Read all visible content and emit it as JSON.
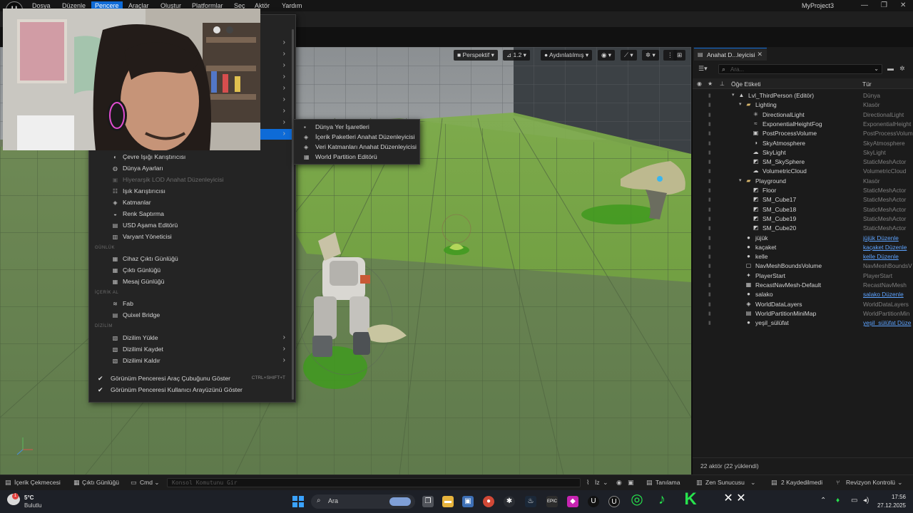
{
  "menubar": {
    "items": [
      "Dosya",
      "Düzenle",
      "Pencere",
      "Araçlar",
      "Oluştur",
      "Platformlar",
      "Seç",
      "Aktör",
      "Yardım"
    ],
    "active_index": 2,
    "project": "MyProject3"
  },
  "viewport": {
    "perspective": "Perspektif",
    "speed": "1.2",
    "lit": "Aydınlatılmış"
  },
  "window_menu": {
    "items": [
      {
        "label": "Çevre Işığı Karıştırıcısı",
        "icon": "bulb-icon"
      },
      {
        "label": "Dünya Ayarları",
        "icon": "globe-icon"
      },
      {
        "label": "Hiyerarşik LOD Anahat Düzenleyicisi",
        "icon": "hlod-icon",
        "disabled": true
      },
      {
        "label": "Işık Karıştırıcısı",
        "icon": "light-mixer-icon"
      },
      {
        "label": "Katmanlar",
        "icon": "layers-icon"
      },
      {
        "label": "Renk Saptırma",
        "icon": "color-icon"
      },
      {
        "label": "USD Aşama Editörü",
        "icon": "usd-icon"
      },
      {
        "label": "Varyant Yöneticisi",
        "icon": "variant-icon"
      }
    ],
    "section_log": "GÜNLÜK",
    "log_items": [
      {
        "label": "Cihaz Çıktı Günlüğü",
        "icon": "device-log-icon"
      },
      {
        "label": "Çıktı Günlüğü",
        "icon": "output-log-icon"
      },
      {
        "label": "Mesaj Günlüğü",
        "icon": "message-log-icon"
      }
    ],
    "section_content": "İÇERİK AL",
    "content_items": [
      {
        "label": "Fab",
        "icon": "fab-icon"
      },
      {
        "label": "Quixel Bridge",
        "icon": "bridge-icon"
      }
    ],
    "section_layout": "DİZİLİM",
    "layout_items": [
      {
        "label": "Dizilim Yükle",
        "icon": "layout-load-icon"
      },
      {
        "label": "Dizilimi Kaydet",
        "icon": "layout-save-icon"
      },
      {
        "label": "Dizilimi Kaldır",
        "icon": "layout-remove-icon"
      }
    ],
    "check_items": [
      {
        "label": "Görünüm Penceresi Araç Çubuğunu Göster",
        "shortcut": "CTRL+SHIFT+T"
      },
      {
        "label": "Görünüm Penceresi Kullanıcı Arayüzünü Göster",
        "shortcut": ""
      }
    ]
  },
  "submenu": {
    "items": [
      {
        "label": "Dünya Yer İşaretleri",
        "icon": "bookmark-icon"
      },
      {
        "label": "İçerik Paketleri Anahat Düzenleyicisi",
        "icon": "content-bundle-icon"
      },
      {
        "label": "Veri Katmanları Anahat Düzenleyicisi",
        "icon": "data-layers-icon"
      },
      {
        "label": "World Partition Editörü",
        "icon": "world-partition-icon"
      }
    ]
  },
  "outliner": {
    "tab_title": "Anahat D...leyicisi",
    "search_placeholder": "Ara...",
    "col_label": "Öğe Etiketi",
    "col_type": "Tür",
    "rows": [
      {
        "label": "Lvl_ThirdPerson (Editör)",
        "type": "Dünya",
        "depth": 0,
        "icon": "level-icon",
        "caret": true
      },
      {
        "label": "Lighting",
        "type": "Klasör",
        "depth": 1,
        "icon": "folder-icon",
        "caret": true
      },
      {
        "label": "DirectionalLight",
        "type": "DirectionalLight",
        "depth": 2,
        "icon": "directional-light-icon"
      },
      {
        "label": "ExponentialHeightFog",
        "type": "ExponentialHeight",
        "depth": 2,
        "icon": "fog-icon"
      },
      {
        "label": "PostProcessVolume",
        "type": "PostProcessVolume",
        "depth": 2,
        "icon": "post-process-icon"
      },
      {
        "label": "SkyAtmosphere",
        "type": "SkyAtmosphere",
        "depth": 2,
        "icon": "sky-atmosphere-icon"
      },
      {
        "label": "SkyLight",
        "type": "SkyLight",
        "depth": 2,
        "icon": "skylight-icon"
      },
      {
        "label": "SM_SkySphere",
        "type": "StaticMeshActor",
        "depth": 2,
        "icon": "static-mesh-icon"
      },
      {
        "label": "VolumetricCloud",
        "type": "VolumetricCloud",
        "depth": 2,
        "icon": "cloud-icon"
      },
      {
        "label": "Playground",
        "type": "Klasör",
        "depth": 1,
        "icon": "folder-icon",
        "caret": true
      },
      {
        "label": "Floor",
        "type": "StaticMeshActor",
        "depth": 2,
        "icon": "static-mesh-icon"
      },
      {
        "label": "SM_Cube17",
        "type": "StaticMeshActor",
        "depth": 2,
        "icon": "static-mesh-icon"
      },
      {
        "label": "SM_Cube18",
        "type": "StaticMeshActor",
        "depth": 2,
        "icon": "static-mesh-icon"
      },
      {
        "label": "SM_Cube19",
        "type": "StaticMeshActor",
        "depth": 2,
        "icon": "static-mesh-icon"
      },
      {
        "label": "SM_Cube20",
        "type": "StaticMeshActor",
        "depth": 2,
        "icon": "static-mesh-icon"
      },
      {
        "label": "jüjük",
        "type": "jüjük Düzenle",
        "depth": 1,
        "icon": "pawn-icon",
        "link": true
      },
      {
        "label": "kaçaket",
        "type": "kaçaket Düzenle",
        "depth": 1,
        "icon": "pawn-icon",
        "link": true
      },
      {
        "label": "kelle",
        "type": "kelle Düzenle",
        "depth": 1,
        "icon": "pawn-icon",
        "link": true
      },
      {
        "label": "NavMeshBoundsVolume",
        "type": "NavMeshBoundsV",
        "depth": 1,
        "icon": "volume-icon"
      },
      {
        "label": "PlayerStart",
        "type": "PlayerStart",
        "depth": 1,
        "icon": "player-start-icon"
      },
      {
        "label": "RecastNavMesh-Default",
        "type": "RecastNavMesh",
        "depth": 1,
        "icon": "navmesh-icon"
      },
      {
        "label": "salako",
        "type": "salako Düzenle",
        "depth": 1,
        "icon": "pawn-icon",
        "link": true
      },
      {
        "label": "WorldDataLayers",
        "type": "WorldDataLayers",
        "depth": 1,
        "icon": "data-layers-icon"
      },
      {
        "label": "WorldPartitionMiniMap",
        "type": "WorldPartitionMin",
        "depth": 1,
        "icon": "minimap-icon"
      },
      {
        "label": "yeşil_sülüfat",
        "type": "yeşil_sülüfat Düze",
        "depth": 1,
        "icon": "pawn-icon",
        "link": true
      }
    ],
    "footer": "22 aktör (22 yüklendi)"
  },
  "statusbar": {
    "content_drawer": "İçerik Çekmecesi",
    "output_log": "Çıktı Günlüğü",
    "cmd": "Cmd",
    "cmd_placeholder": "Konsol Komutunu Gir",
    "trace": "İz",
    "diagnostics": "Tanılama",
    "zen": "Zen Sunucusu",
    "unsaved": "2 Kaydedilmedi",
    "revision": "Revizyon Kontrolü"
  },
  "taskbar": {
    "temp": "5°C",
    "weather": "Bulutlu",
    "search": "Ara",
    "time": "17:56",
    "date": "27.12.2025"
  }
}
